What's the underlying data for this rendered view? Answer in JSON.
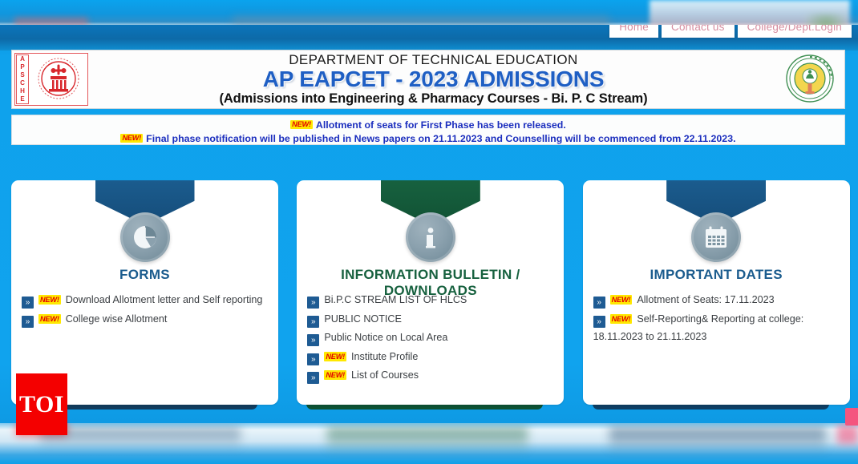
{
  "nav": {
    "items": [
      {
        "label": "Home",
        "name": "nav-home"
      },
      {
        "label": "Contact us",
        "name": "nav-contact-us"
      },
      {
        "label": "College/Dept.Login",
        "name": "nav-college-dept-login"
      }
    ]
  },
  "header": {
    "left_logo_letters": [
      "A",
      "P",
      "S",
      "C",
      "H",
      "E"
    ],
    "left_logo_name": "apsche-logo",
    "right_logo_name": "andhra-pradesh-government-emblem",
    "department_line": "DEPARTMENT OF TECHNICAL EDUCATION",
    "main_title": "AP EAPCET - 2023 ADMISSIONS",
    "sub_title": "(Admissions into Engineering & Pharmacy Courses -  Bi. P. C Stream)"
  },
  "ticker": {
    "new_badge": "NEW!",
    "lines": [
      "Allotment of seats for First Phase has been released.",
      "Final phase notification will be published in News papers on 21.11.2023 and Counselling will be commenced from 22.11.2023."
    ]
  },
  "cards": [
    {
      "title": "FORMS",
      "icon": "pie-chart-icon",
      "accent": "#1b5c8e",
      "items": [
        {
          "new": true,
          "label": "Download Allotment letter and Self reporting"
        },
        {
          "new": true,
          "label": "College wise Allotment"
        }
      ]
    },
    {
      "title": "INFORMATION BULLETIN / DOWNLOADS",
      "icon": "info-icon",
      "accent": "#17613f",
      "items": [
        {
          "new": false,
          "label": "Bi.P.C STREAM LIST OF HLCS"
        },
        {
          "new": false,
          "label": "PUBLIC NOTICE"
        },
        {
          "new": false,
          "label": "Public Notice on Local Area"
        },
        {
          "new": true,
          "label": "Institute Profile"
        },
        {
          "new": true,
          "label": "List of Courses"
        }
      ]
    },
    {
      "title": "IMPORTANT DATES",
      "icon": "calendar-icon",
      "accent": "#1b5c8e",
      "items": [
        {
          "new": true,
          "label": "Allotment of Seats: 17.11.2023"
        },
        {
          "new": true,
          "label": "Self-Reporting& Reporting at college: 18.11.2023 to 21.11.2023"
        }
      ]
    }
  ],
  "watermark": {
    "label": "TOI"
  },
  "arrow_glyph": "»",
  "item_new_badge": "NEW!"
}
